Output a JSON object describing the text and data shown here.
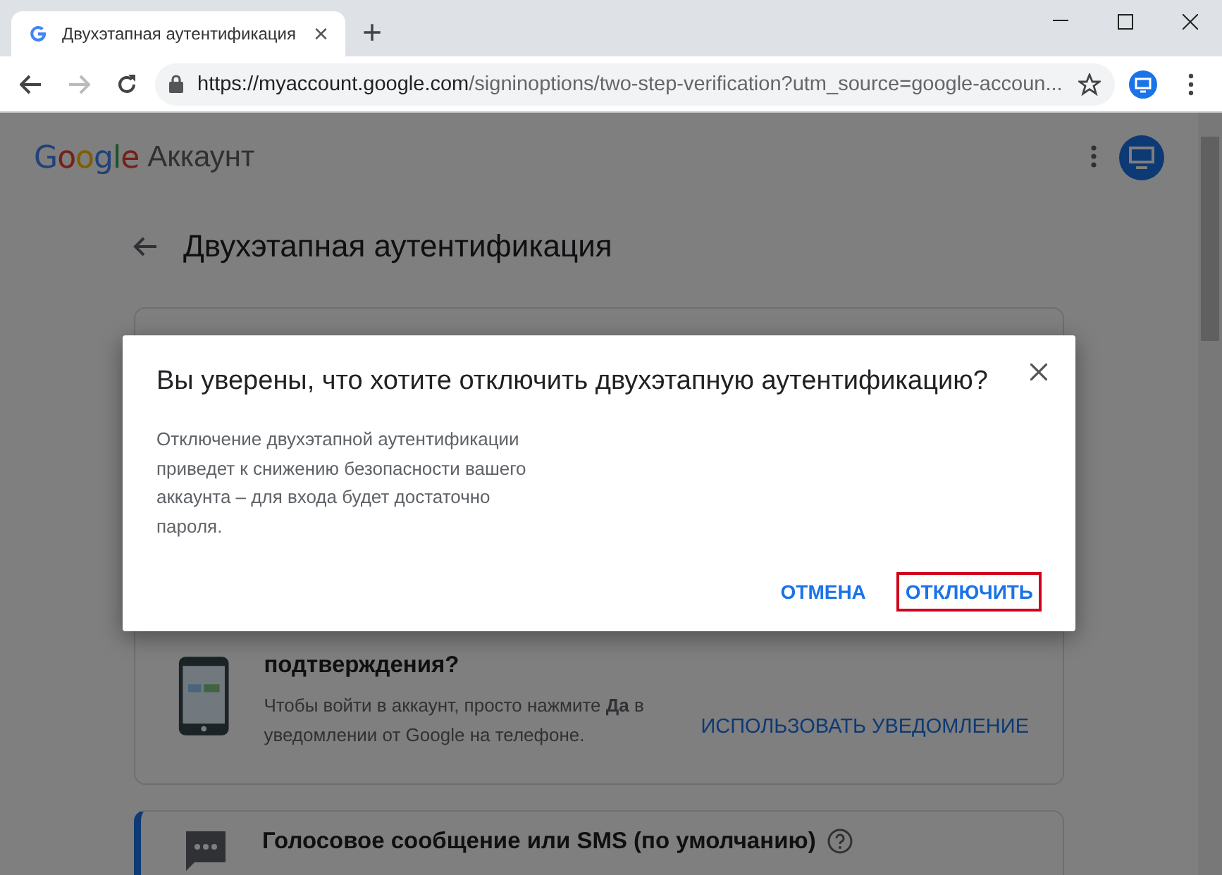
{
  "browser": {
    "tab": {
      "title": "Двухэтапная аутентификация",
      "close": "×"
    },
    "new_tab": "+",
    "url": {
      "host": "https://myaccount.google.com",
      "path": "/signinoptions/two-step-verification?utm_source=google-accoun..."
    }
  },
  "header": {
    "logo": "Google",
    "product": "Аккаунт"
  },
  "page_title": "Двухэтапная аутентификация",
  "cards": [
    {
      "kind": "prompt",
      "title": "подтверждения?",
      "description": "Чтобы войти в аккаунт, просто нажмите **Да** в уведомлении от Google на телефоне.",
      "action": "ИСПОЛЬЗОВАТЬ УВЕДОМЛЕНИЕ",
      "selected": false
    },
    {
      "kind": "sms",
      "title": "Голосовое сообщение или SMS",
      "title_suffix": "(по умолчанию)",
      "selected": true
    }
  ],
  "dialog": {
    "title": "Вы уверены, что хотите отключить двухэтапную аутентификацию?",
    "body": "Отключение двухэтапной аутентификации приведет к снижению безопасности вашего аккаунта – для входа будет достаточно пароля.",
    "buttons": [
      {
        "label": "ОТМЕНА",
        "highlighted": false
      },
      {
        "label": "ОТКЛЮЧИТЬ",
        "highlighted": true
      }
    ]
  }
}
